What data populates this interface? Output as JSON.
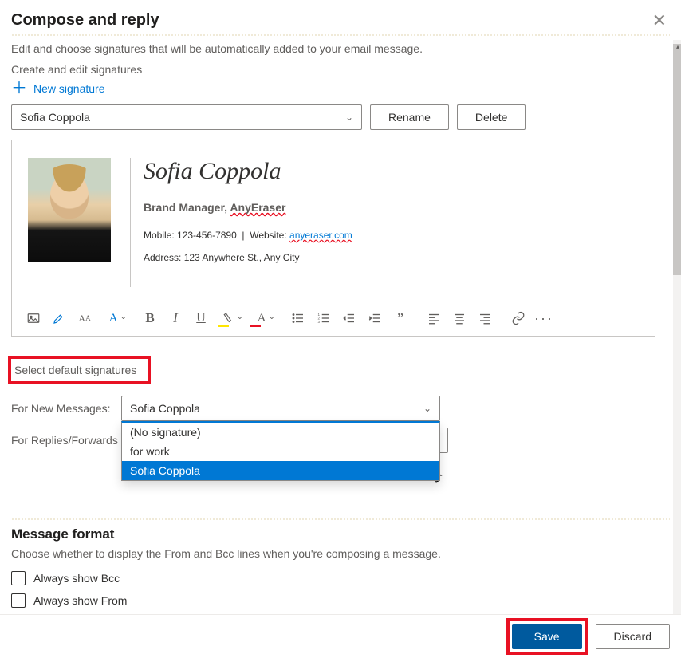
{
  "header": {
    "title": "Compose and reply",
    "subtitle": "Edit and choose signatures that will be automatically added to your email message."
  },
  "signatures": {
    "section_label": "Create and edit signatures",
    "new_label": "New signature",
    "selected": "Sofia Coppola",
    "rename_label": "Rename",
    "delete_label": "Delete"
  },
  "signature_preview": {
    "name": "Sofia Coppola",
    "role_prefix": "Brand Manager, ",
    "role_company": "AnyEraser",
    "mobile_label": "Mobile: ",
    "mobile_value": "123-456-7890",
    "website_label": "Website: ",
    "website_value": "anyeraser.com",
    "address_label": "Address: ",
    "address_value": "123 Anywhere St., Any City"
  },
  "toolbar": {
    "bold": "B",
    "italic": "I",
    "underline": "U",
    "quote": "”"
  },
  "defaults": {
    "heading": "Select default signatures",
    "for_new_label": "For New Messages:",
    "for_new_value": "Sofia Coppola",
    "for_replies_label": "For Replies/Forwards",
    "options": [
      "(No signature)",
      "for work",
      "Sofia Coppola"
    ]
  },
  "message_format": {
    "heading": "Message format",
    "desc": "Choose whether to display the From and Bcc lines when you're composing a message.",
    "show_bcc": "Always show Bcc",
    "show_from": "Always show From"
  },
  "footer": {
    "save": "Save",
    "discard": "Discard"
  }
}
